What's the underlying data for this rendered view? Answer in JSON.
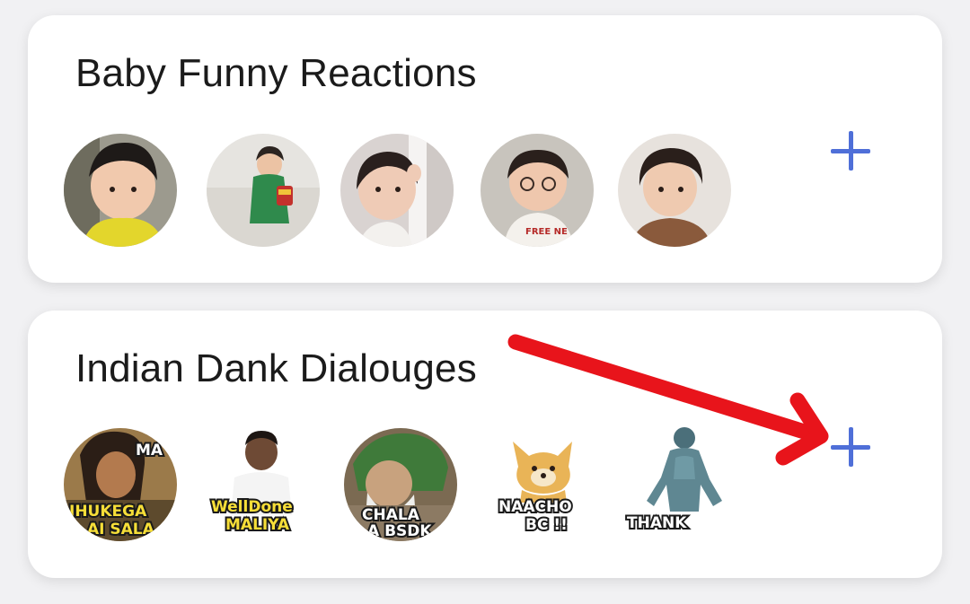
{
  "packs": [
    {
      "title": "Baby Funny Reactions",
      "thumbnails": [
        "baby-sticker-1",
        "baby-sticker-2",
        "baby-sticker-3",
        "baby-sticker-4",
        "baby-sticker-5"
      ],
      "add_icon": "plus-icon"
    },
    {
      "title": "Indian Dank Dialouges",
      "thumbnails": [
        "dialogue-sticker-1",
        "dialogue-sticker-2",
        "dialogue-sticker-3",
        "dialogue-sticker-4",
        "dialogue-sticker-5"
      ],
      "sticker_texts": [
        {
          "top": "MA",
          "bottom": "JHUKEGA",
          "bottom2": "AI SALA"
        },
        {
          "top": "",
          "bottom": "WellDone",
          "bottom2": "MALIYA"
        },
        {
          "top": "",
          "bottom": "CHALA",
          "bottom2": "A BSDK"
        },
        {
          "top": "",
          "bottom": "NAACHO",
          "bottom2": "BC !!"
        },
        {
          "top": "",
          "bottom": "THANK",
          "bottom2": ""
        }
      ],
      "add_icon": "plus-icon"
    }
  ],
  "colors": {
    "accent": "#4f6fd8",
    "annotation_arrow": "#e8141b",
    "card": "#ffffff",
    "background": "#f1f1f3"
  },
  "annotation": {
    "icon": "red-arrow-pointing-to-add-icon"
  }
}
